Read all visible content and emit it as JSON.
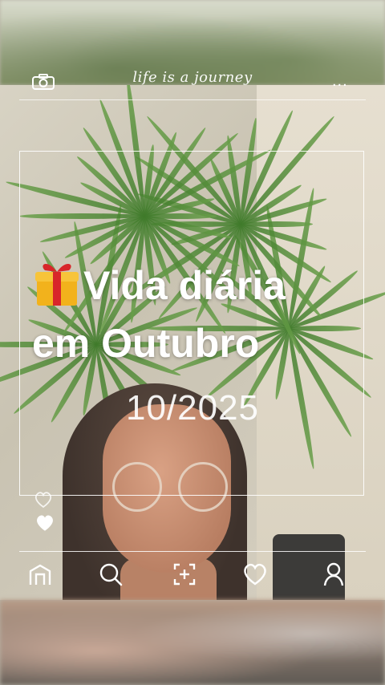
{
  "header": {
    "brand_text": "life is a journey",
    "left_icon": "camera-icon",
    "right_icon": "more-dots-icon",
    "more_label": "..."
  },
  "post": {
    "title_line1": "Vida diária",
    "title_line2": "em Outubro",
    "title_emoji": "gift-icon",
    "date": "10/2025"
  },
  "side_icons": [
    "heart-outline-icon",
    "heart-filled-icon"
  ],
  "bottom_nav": {
    "items": [
      {
        "icon": "home-icon"
      },
      {
        "icon": "search-icon"
      },
      {
        "icon": "add-post-icon"
      },
      {
        "icon": "heart-icon"
      },
      {
        "icon": "profile-icon"
      }
    ]
  },
  "colors": {
    "overlay": "#ffffff",
    "gift_box": "#f2b21c",
    "gift_ribbon": "#d8262a"
  }
}
